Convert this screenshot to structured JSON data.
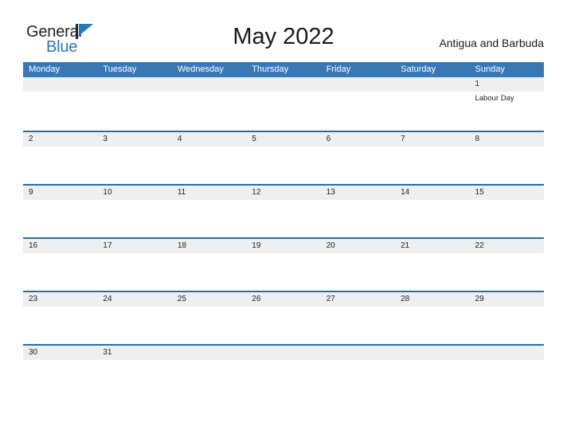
{
  "brand": {
    "word_one": "General",
    "word_two": "Blue",
    "flag_icon": "blue-triangle-flag-icon",
    "color_dark": "#231f20",
    "color_blue": "#1f7ac4"
  },
  "header": {
    "title": "May 2022",
    "country": "Antigua and Barbuda"
  },
  "theme": {
    "header_blue": "#3a78b5",
    "rule_blue": "#2e6da4",
    "band_gray": "#efefef",
    "text": "#222222"
  },
  "calendar": {
    "weekday_headers": [
      "Monday",
      "Tuesday",
      "Wednesday",
      "Thursday",
      "Friday",
      "Saturday",
      "Sunday"
    ],
    "weeks": [
      {
        "days": [
          {
            "num": "",
            "events": []
          },
          {
            "num": "",
            "events": []
          },
          {
            "num": "",
            "events": []
          },
          {
            "num": "",
            "events": []
          },
          {
            "num": "",
            "events": []
          },
          {
            "num": "",
            "events": []
          },
          {
            "num": "1",
            "events": [
              "Labour Day"
            ]
          }
        ]
      },
      {
        "days": [
          {
            "num": "2",
            "events": []
          },
          {
            "num": "3",
            "events": []
          },
          {
            "num": "4",
            "events": []
          },
          {
            "num": "5",
            "events": []
          },
          {
            "num": "6",
            "events": []
          },
          {
            "num": "7",
            "events": []
          },
          {
            "num": "8",
            "events": []
          }
        ]
      },
      {
        "days": [
          {
            "num": "9",
            "events": []
          },
          {
            "num": "10",
            "events": []
          },
          {
            "num": "11",
            "events": []
          },
          {
            "num": "12",
            "events": []
          },
          {
            "num": "13",
            "events": []
          },
          {
            "num": "14",
            "events": []
          },
          {
            "num": "15",
            "events": []
          }
        ]
      },
      {
        "days": [
          {
            "num": "16",
            "events": []
          },
          {
            "num": "17",
            "events": []
          },
          {
            "num": "18",
            "events": []
          },
          {
            "num": "19",
            "events": []
          },
          {
            "num": "20",
            "events": []
          },
          {
            "num": "21",
            "events": []
          },
          {
            "num": "22",
            "events": []
          }
        ]
      },
      {
        "days": [
          {
            "num": "23",
            "events": []
          },
          {
            "num": "24",
            "events": []
          },
          {
            "num": "25",
            "events": []
          },
          {
            "num": "26",
            "events": []
          },
          {
            "num": "27",
            "events": []
          },
          {
            "num": "28",
            "events": []
          },
          {
            "num": "29",
            "events": []
          }
        ]
      },
      {
        "days": [
          {
            "num": "30",
            "events": []
          },
          {
            "num": "31",
            "events": []
          },
          {
            "num": "",
            "events": []
          },
          {
            "num": "",
            "events": []
          },
          {
            "num": "",
            "events": []
          },
          {
            "num": "",
            "events": []
          },
          {
            "num": "",
            "events": []
          }
        ]
      }
    ]
  }
}
